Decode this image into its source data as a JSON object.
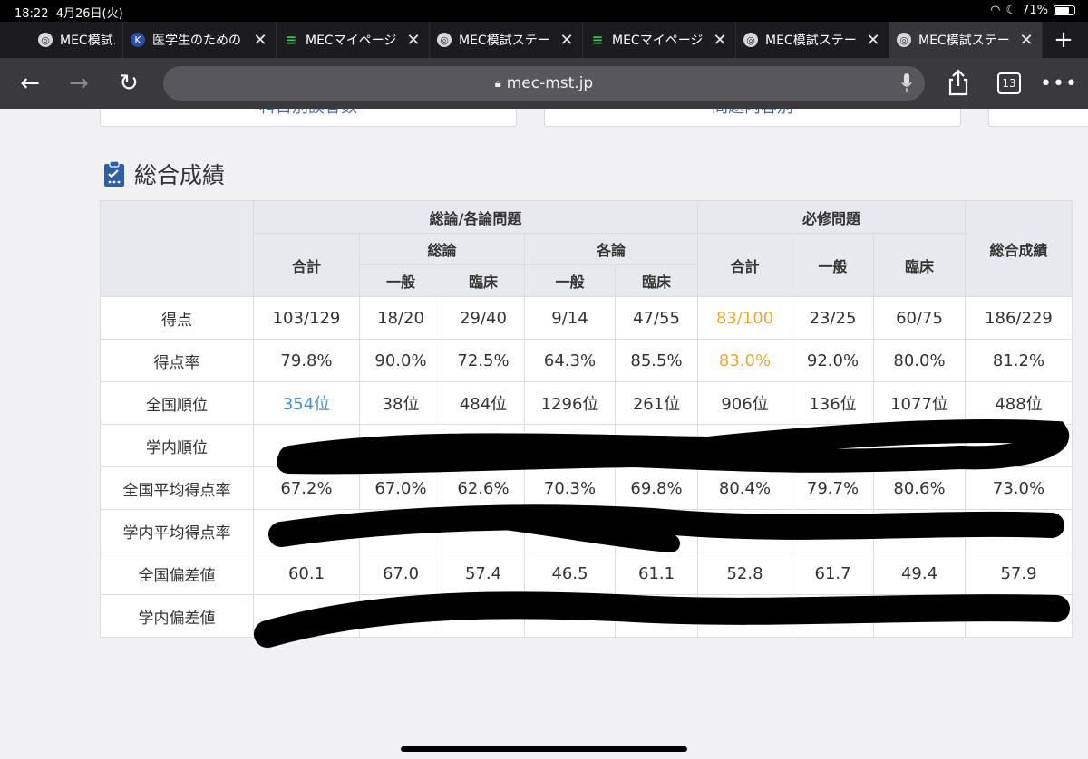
{
  "status": {
    "time": "18:22",
    "date": "4月26日(火)",
    "battery": "71%"
  },
  "tabs": [
    {
      "title": "MEC模試ス",
      "icon": "globe-icon",
      "closable": false
    },
    {
      "title": "医学生のための",
      "icon": "k-icon",
      "closable": true
    },
    {
      "title": "MECマイページ",
      "icon": "mec-icon",
      "closable": true
    },
    {
      "title": "MEC模試ステー",
      "icon": "globe-icon",
      "closable": true
    },
    {
      "title": "MECマイページ",
      "icon": "mec-icon",
      "closable": true
    },
    {
      "title": "MEC模試ステー",
      "icon": "globe-icon",
      "closable": true
    },
    {
      "title": "MEC模試ステー",
      "icon": "globe-icon",
      "closable": true,
      "active": true
    }
  ],
  "toolbar": {
    "url": "mec-mst.jp",
    "tab_count": "13"
  },
  "top_buttons": [
    "科目別誤答数",
    "問題内容別"
  ],
  "section_title": "総合成績",
  "table": {
    "group_headers": {
      "general": "総論/各論問題",
      "required": "必修問題",
      "total": "総合成績"
    },
    "sub_headers": {
      "sum": "合計",
      "soron": "総論",
      "kakuron": "各論",
      "ippan": "一般",
      "rinsho": "臨床"
    },
    "rows": [
      {
        "label": "得点",
        "values": [
          "103/129",
          "18/20",
          "29/40",
          "9/14",
          "47/55",
          "83/100",
          "23/25",
          "60/75",
          "186/229"
        ]
      },
      {
        "label": "得点率",
        "values": [
          "79.8%",
          "90.0%",
          "72.5%",
          "64.3%",
          "85.5%",
          "83.0%",
          "92.0%",
          "80.0%",
          "81.2%"
        ]
      },
      {
        "label": "全国順位",
        "values": [
          "354位",
          "38位",
          "484位",
          "1296位",
          "261位",
          "906位",
          "136位",
          "1077位",
          "488位"
        ]
      },
      {
        "label": "学内順位",
        "values": [
          "",
          "",
          "",
          "",
          "",
          "",
          "",
          "",
          ""
        ]
      },
      {
        "label": "全国平均得点率",
        "values": [
          "67.2%",
          "67.0%",
          "62.6%",
          "70.3%",
          "69.8%",
          "80.4%",
          "79.7%",
          "80.6%",
          "73.0%"
        ]
      },
      {
        "label": "学内平均得点率",
        "values": [
          "",
          "",
          "",
          "",
          "",
          "",
          "",
          "",
          ""
        ]
      },
      {
        "label": "全国偏差値",
        "values": [
          "60.1",
          "67.0",
          "57.4",
          "46.5",
          "61.1",
          "52.8",
          "61.7",
          "49.4",
          "57.9"
        ]
      },
      {
        "label": "学内偏差値",
        "values": [
          "",
          "",
          "",
          "",
          "",
          "",
          "",
          "",
          ""
        ]
      }
    ],
    "highlight_colors": {
      "link": "#4a90c8",
      "required": "#e8a93b"
    }
  }
}
